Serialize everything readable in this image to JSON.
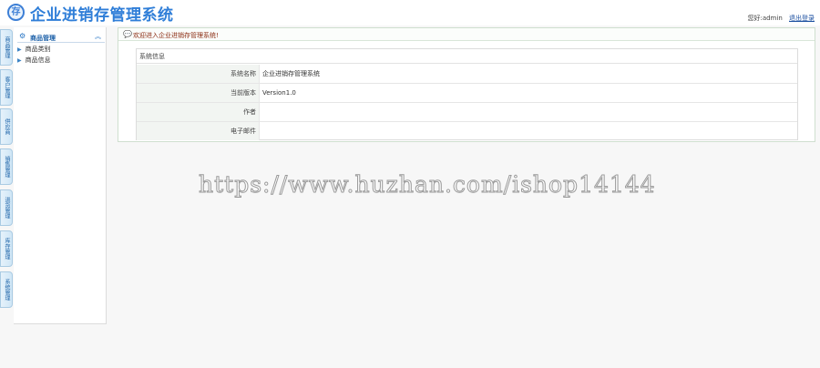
{
  "header": {
    "logo_glyph": "存",
    "title": "企业进销存管理系统",
    "greeting": "您好:admin",
    "logout_label": "退出登录"
  },
  "vtabs": [
    "商品管理",
    "客户管理",
    "供应商",
    "销售管理",
    "进货管理",
    "库存管理",
    "系统管理"
  ],
  "sidebar": {
    "header_title": "商品管理",
    "header_icon": "gear-icon",
    "collapse_glyph": "︽",
    "items": [
      {
        "label": "商品类别"
      },
      {
        "label": "商品信息"
      }
    ]
  },
  "notice": {
    "icon": "speech-bubble-icon",
    "text": "欢迎进入企业进销存管理系统!"
  },
  "info": {
    "caption": "系统信息",
    "rows": [
      {
        "label": "系统名称",
        "value": "企业进销存管理系统"
      },
      {
        "label": "当前版本",
        "value": "Version1.0"
      },
      {
        "label": "作者",
        "value": ""
      },
      {
        "label": "电子邮件",
        "value": ""
      }
    ]
  },
  "watermark": "https://www.huzhan.com/ishop14144",
  "colors": {
    "title_blue": "#2f7ed8",
    "notice_text": "#8b2c12",
    "link_blue": "#1b4fa0"
  }
}
